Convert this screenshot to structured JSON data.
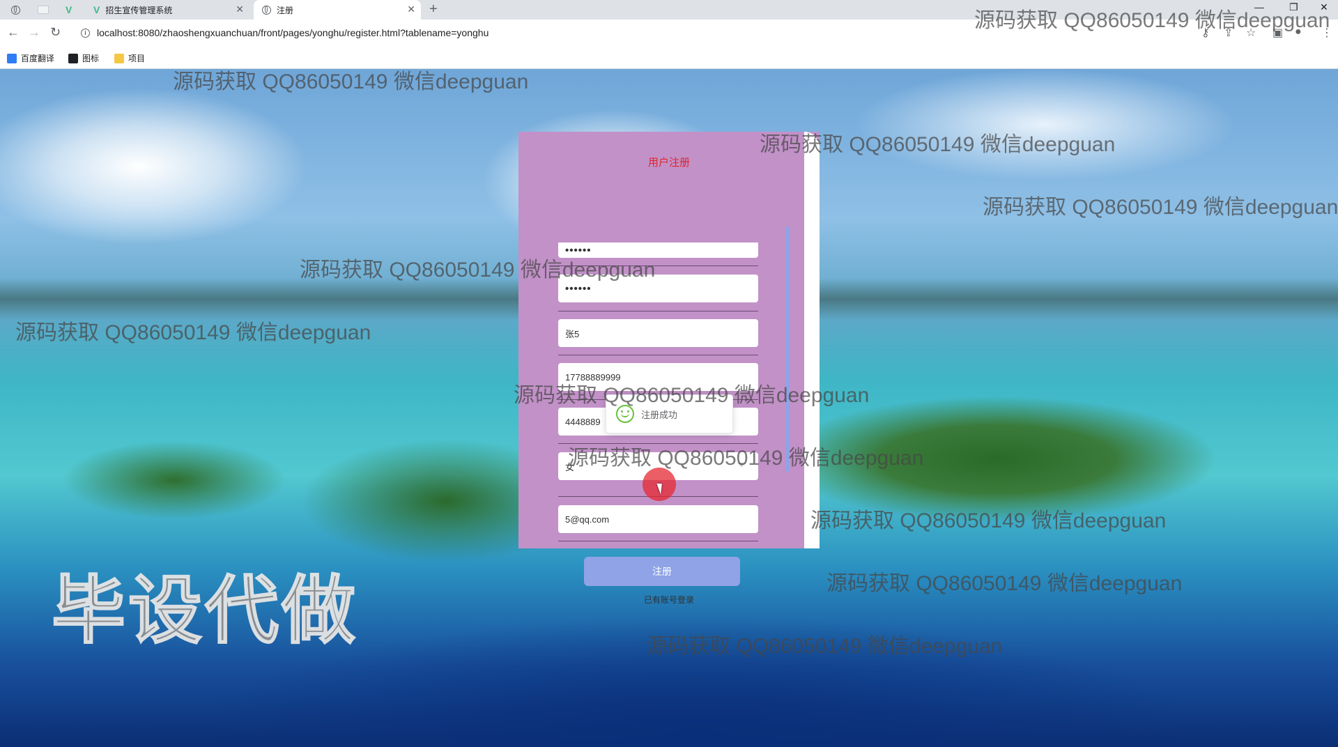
{
  "browser": {
    "tabs": [
      {
        "title": "",
        "icon": "globe-icon"
      },
      {
        "title": "",
        "icon": "blank-page-icon"
      },
      {
        "title": "",
        "icon": "vue-logo-icon"
      },
      {
        "title": "招生宣传管理系统",
        "icon": "vue-logo-icon"
      },
      {
        "title": "注册",
        "icon": "globe-icon",
        "active": true
      }
    ],
    "url": "localhost:8080/zhaoshengxuanchuan/front/pages/yonghu/register.html?tablename=yonghu",
    "bookmarks": [
      {
        "label": "百度翻译",
        "icon": "baidu-translate-icon"
      },
      {
        "label": "图标",
        "icon": "image-icon"
      },
      {
        "label": "项目",
        "icon": "folder-icon"
      }
    ]
  },
  "watermark_text": "源码获取 QQ86050149 微信deepguan",
  "big_watermark": "毕设代做",
  "register": {
    "title": "用户注册",
    "fields": {
      "password": "••••••",
      "confirm_password": "••••••",
      "name": "张5",
      "phone": "17788889999",
      "id_number": "4448889",
      "gender": "女",
      "email": "5@qq.com"
    },
    "toast": "注册成功",
    "submit_label": "注册",
    "login_link": "已有账号登录"
  },
  "colors": {
    "card_bg": "#c291c8",
    "title_red": "#e2232b",
    "button_blue": "#8fa3e6",
    "success_green": "#67c23a"
  }
}
